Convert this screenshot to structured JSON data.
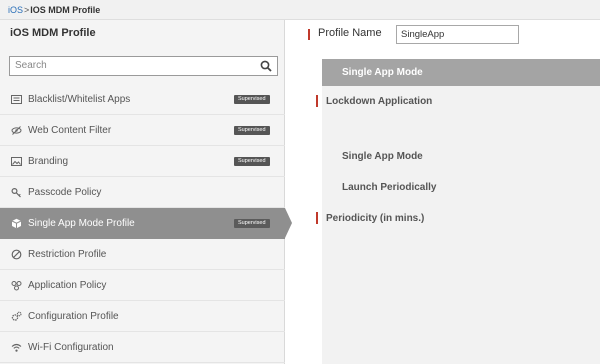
{
  "breadcrumb": {
    "root": "iOS",
    "separator": ">",
    "current": "IOS MDM Profile"
  },
  "sidebar": {
    "title": "iOS MDM Profile",
    "search_placeholder": "Search",
    "items": [
      {
        "label": "Blacklist/Whitelist Apps",
        "icon": "list-icon",
        "badge": "Supervised"
      },
      {
        "label": "Web Content Filter",
        "icon": "eye-off-icon",
        "badge": "Supervised"
      },
      {
        "label": "Branding",
        "icon": "image-icon",
        "badge": "Supervised"
      },
      {
        "label": "Passcode Policy",
        "icon": "key-icon",
        "badge": ""
      },
      {
        "label": "Single App Mode Profile",
        "icon": "cube-icon",
        "badge": "Supervised",
        "active": true
      },
      {
        "label": "Restriction Profile",
        "icon": "block-icon",
        "badge": ""
      },
      {
        "label": "Application Policy",
        "icon": "apps-icon",
        "badge": ""
      },
      {
        "label": "Configuration Profile",
        "icon": "cog-icon",
        "badge": ""
      },
      {
        "label": "Wi-Fi Configuration",
        "icon": "wifi-icon",
        "badge": ""
      }
    ]
  },
  "form": {
    "profile_name_label": "Profile Name",
    "profile_name_value": "SingleApp",
    "section_title": "Single App Mode",
    "lockdown_label": "Lockdown Application",
    "single_app_mode_label": "Single App Mode",
    "launch_periodically_label": "Launch Periodically",
    "periodicity_label": "Periodicity (in mins.)"
  },
  "colors": {
    "accent_marker": "#c0392b",
    "active_item_bg": "#8f8f8f",
    "link": "#2a6fb8"
  }
}
